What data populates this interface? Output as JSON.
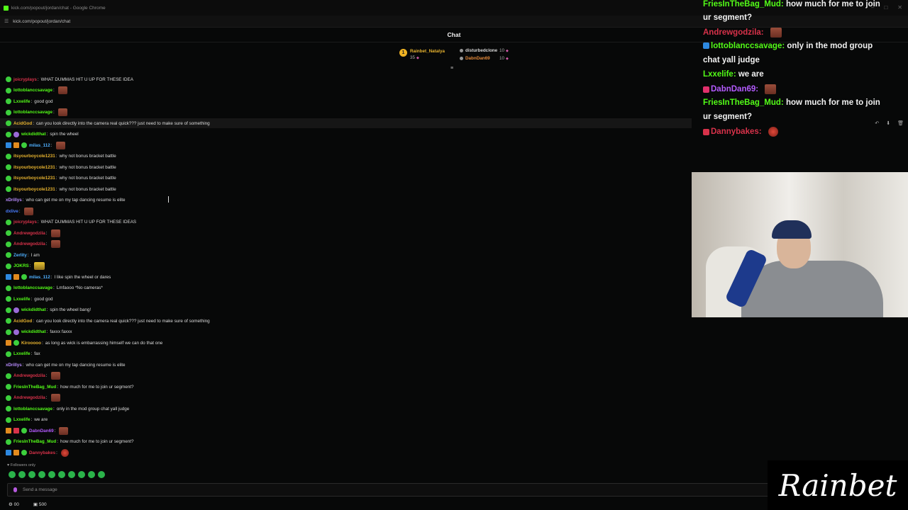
{
  "browser": {
    "window_title": "kick.com/popout/jordan/chat - Google Chrome",
    "url": "kick.com/popout/jordan/chat"
  },
  "chat": {
    "title": "Chat",
    "leaderboard": [
      {
        "rank": "1",
        "name": "Rainbet_Natalya",
        "count": "35"
      },
      {
        "name": "disturbedclone",
        "count": "10"
      },
      {
        "name": "DabnDan69",
        "count": "10"
      }
    ],
    "messages": [
      {
        "user": "joicryplays",
        "color": "#d8324a",
        "badges": [
          "green"
        ],
        "text": "WHAT DUMMAS HIT U UP FOR THESE IDEA"
      },
      {
        "user": "lottoblanccsavage",
        "color": "#53fc18",
        "badges": [
          "green"
        ],
        "text": "",
        "emote": "brown"
      },
      {
        "user": "Lxxelife",
        "color": "#53fc18",
        "badges": [
          "green"
        ],
        "text": "good god"
      },
      {
        "user": "lottoblanccsavage",
        "color": "#53fc18",
        "badges": [
          "green"
        ],
        "text": "",
        "emote": "brown"
      },
      {
        "user": "AcidGod",
        "color": "#e7b32f",
        "badges": [
          "green"
        ],
        "text": "can you look directly into the camera real quick??? just need to make sure of something",
        "hl": true
      },
      {
        "user": "wickdidthat",
        "color": "#53fc18",
        "badges": [
          "green",
          "purple"
        ],
        "text": "spin the wheel"
      },
      {
        "user": "milas_112",
        "color": "#4fb0ff",
        "badges": [
          "blue",
          "orange",
          "green"
        ],
        "text": "",
        "emote": "brown"
      },
      {
        "user": "itsyourboycole1231",
        "color": "#e7b32f",
        "badges": [
          "green"
        ],
        "text": "why not bonus bracket battle"
      },
      {
        "user": "itsyourboycole1231",
        "color": "#e7b32f",
        "badges": [
          "green"
        ],
        "text": "why not bonus bracket battle"
      },
      {
        "user": "itsyourboycole1231",
        "color": "#e7b32f",
        "badges": [
          "green"
        ],
        "text": "why not bonus bracket battle"
      },
      {
        "user": "itsyourboycole1231",
        "color": "#e7b32f",
        "badges": [
          "green"
        ],
        "text": "why not bonus bracket battle"
      },
      {
        "user": "xDrillys",
        "color": "#b98cff",
        "badges": [],
        "text": "who can get me on my tap dancing resume is elite"
      },
      {
        "user": "dxlive",
        "color": "#4a7dff",
        "badges": [],
        "text": "",
        "emote": "brown"
      },
      {
        "user": "joicryplays",
        "color": "#d8324a",
        "badges": [
          "green"
        ],
        "text": "WHAT DUMMAS HIT U UP FOR THESE IDEAS"
      },
      {
        "user": "Andrewgodzila",
        "color": "#d8324a",
        "badges": [
          "green"
        ],
        "text": "",
        "emote": "brown"
      },
      {
        "user": "Andrewgodzila",
        "color": "#d8324a",
        "badges": [
          "green"
        ],
        "text": "",
        "emote": "brown"
      },
      {
        "user": "Zerlity",
        "color": "#4fb0ff",
        "badges": [
          "green"
        ],
        "text": "I am"
      },
      {
        "user": "JOKRS",
        "color": "#53fc18",
        "badges": [
          "green"
        ],
        "text": "",
        "emote": "yellow"
      },
      {
        "user": "milas_112",
        "color": "#4fb0ff",
        "badges": [
          "blue",
          "orange",
          "green"
        ],
        "text": "I like spin the wheel or dares"
      },
      {
        "user": "lottoblanccsavage",
        "color": "#53fc18",
        "badges": [
          "green"
        ],
        "text": "Lmfaooo *No cameras*"
      },
      {
        "user": "Lxxelife",
        "color": "#53fc18",
        "badges": [
          "green"
        ],
        "text": "good god"
      },
      {
        "user": "wickdidthat",
        "color": "#53fc18",
        "badges": [
          "green",
          "purple"
        ],
        "text": "spin the wheel bang!"
      },
      {
        "user": "AcidGod",
        "color": "#e7b32f",
        "badges": [
          "green"
        ],
        "text": "can you look directly into the camera real quick??? just need to make sure of something"
      },
      {
        "user": "wickdidthat",
        "color": "#53fc18",
        "badges": [
          "green",
          "purple"
        ],
        "text": "faxxx faxxx"
      },
      {
        "user": "Kirooooo",
        "color": "#e7b32f",
        "badges": [
          "orange",
          "green"
        ],
        "text": "as long as wick is embarrassing himself we can do that one"
      },
      {
        "user": "Lxxelife",
        "color": "#53fc18",
        "badges": [
          "green"
        ],
        "text": "fax"
      },
      {
        "user": "xDrillys",
        "color": "#b98cff",
        "badges": [],
        "text": "who can get me on my tap dancing resume is elite"
      },
      {
        "user": "Andrewgodzila",
        "color": "#d8324a",
        "badges": [
          "green"
        ],
        "text": "",
        "emote": "brown"
      },
      {
        "user": "FriesInTheBag_Mud",
        "color": "#53fc18",
        "badges": [
          "green"
        ],
        "text": "how much for me to join ur segment?"
      },
      {
        "user": "Andrewgodzila",
        "color": "#d8324a",
        "badges": [
          "green"
        ],
        "text": "",
        "emote": "brown"
      },
      {
        "user": "lottoblanccsavage",
        "color": "#53fc18",
        "badges": [
          "green"
        ],
        "text": "only in the mod group chat yall judge"
      },
      {
        "user": "Lxxelife",
        "color": "#53fc18",
        "badges": [
          "green"
        ],
        "text": "we are"
      },
      {
        "user": "DabnDan69",
        "color": "#b45bff",
        "badges": [
          "orange",
          "red",
          "green"
        ],
        "text": "",
        "emote": "brown"
      },
      {
        "user": "FriesInTheBag_Mud",
        "color": "#53fc18",
        "badges": [
          "green"
        ],
        "text": "how much for me to join ur segment?"
      },
      {
        "user": "Dannybakes",
        "color": "#d8324a",
        "badges": [
          "blue",
          "orange",
          "green"
        ],
        "text": "",
        "emote": "red"
      }
    ],
    "followers_only": "Followers only",
    "input_placeholder": "Send a message",
    "bottom_left": "00",
    "bottom_points": "500"
  },
  "overlay": {
    "lines": [
      {
        "user": "FriesInTheBag_Mud",
        "color": "#53fc18",
        "text": "how much for me to join"
      },
      {
        "user": "",
        "color": "#53fc18",
        "text": "ur segment?"
      },
      {
        "user": "Andrewgodzila",
        "color": "#d8324a",
        "text": "",
        "emote": "brown"
      },
      {
        "user": "lottoblanccsavage",
        "color": "#53fc18",
        "text": "only in the mod group",
        "badge": "#2d88e0"
      },
      {
        "user": "",
        "color": "#53fc18",
        "text": "chat yall judge"
      },
      {
        "user": "Lxxelife",
        "color": "#53fc18",
        "text": "we are"
      },
      {
        "user": "DabnDan69",
        "color": "#b45bff",
        "text": "",
        "emote": "brown",
        "badge": "#e1306c"
      },
      {
        "user": "FriesInTheBag_Mud",
        "color": "#53fc18",
        "text": "how much for me to join"
      },
      {
        "user": "",
        "color": "#53fc18",
        "text": "ur segment?"
      },
      {
        "user": "Dannybakes",
        "color": "#d8324a",
        "text": "",
        "emote": "red",
        "badge": "#d8324a"
      }
    ]
  },
  "brand": {
    "logo_text": "Rainbet"
  },
  "colors": {
    "kick_green": "#53fc18",
    "background": "#070808",
    "accent_gold": "#e7b32f"
  }
}
